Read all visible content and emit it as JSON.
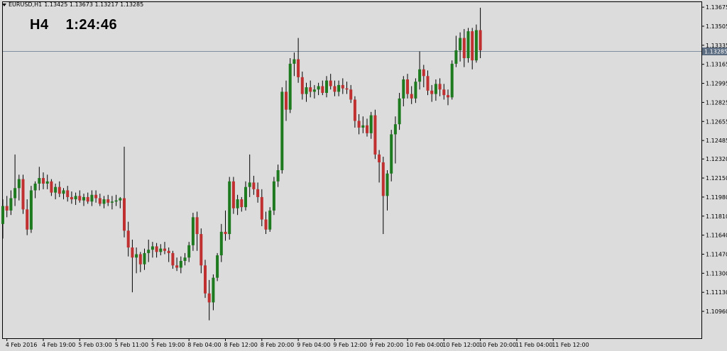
{
  "header": {
    "symbol": "EURUSD,H1",
    "ohlc": "1.13425 1.13673 1.13217 1.13285"
  },
  "timer": {
    "timeframe": "H4",
    "countdown": "1:24:46"
  },
  "colors": {
    "background": "#dcdcdc",
    "bull": "#1e7a1e",
    "bear": "#c03030",
    "wick": "#000000",
    "price_line": "#7f8fa0",
    "price_tag_bg": "#5c6d82",
    "grid_border": "#000000"
  },
  "chart_data": {
    "type": "candlestick",
    "symbol": "EURUSD",
    "period": "H1",
    "ylim": [
      1.1072,
      1.1372
    ],
    "current_price": 1.13285,
    "current_price_label": "1.13285",
    "y_ticks": [
      1.13675,
      1.13505,
      1.13335,
      1.13165,
      1.12995,
      1.12825,
      1.12655,
      1.12485,
      1.1232,
      1.1215,
      1.1198,
      1.1181,
      1.1164,
      1.1147,
      1.113,
      1.1113,
      1.1096
    ],
    "y_tick_labels": [
      "1.13675",
      "1.13505",
      "1.13335",
      "1.13165",
      "1.12995",
      "1.12825",
      "1.12655",
      "1.12485",
      "1.12320",
      "1.12150",
      "1.11980",
      "1.11810",
      "1.11640",
      "1.11470",
      "1.11300",
      "1.11130",
      "1.10960"
    ],
    "x_labels": [
      "4 Feb 2016",
      "4 Feb 19:00",
      "5 Feb 03:00",
      "5 Feb 11:00",
      "5 Feb 19:00",
      "8 Feb 04:00",
      "8 Feb 12:00",
      "8 Feb 20:00",
      "9 Feb 04:00",
      "9 Feb 12:00",
      "9 Feb 20:00",
      "10 Feb 04:00",
      "10 Feb 12:00",
      "10 Feb 20:00",
      "11 Feb 04:00",
      "11 Feb 12:00"
    ],
    "x_label_bars": [
      1,
      10,
      19,
      28,
      37,
      46,
      55,
      64,
      73,
      82,
      91,
      100,
      109,
      118,
      127,
      136
    ],
    "candles": [
      [
        1.1174,
        1.1196,
        1.1161,
        1.119
      ],
      [
        1.119,
        1.1199,
        1.118,
        1.1186
      ],
      [
        1.1186,
        1.1204,
        1.1182,
        1.1197
      ],
      [
        1.1197,
        1.1236,
        1.119,
        1.1206
      ],
      [
        1.1206,
        1.1218,
        1.1195,
        1.1214
      ],
      [
        1.1214,
        1.1218,
        1.1183,
        1.1187
      ],
      [
        1.1187,
        1.1196,
        1.1164,
        1.1169
      ],
      [
        1.1169,
        1.1208,
        1.1166,
        1.1204
      ],
      [
        1.1204,
        1.1212,
        1.1197,
        1.121
      ],
      [
        1.121,
        1.1225,
        1.1204,
        1.1215
      ],
      [
        1.1215,
        1.122,
        1.1205,
        1.121
      ],
      [
        1.121,
        1.1218,
        1.1205,
        1.1212
      ],
      [
        1.1212,
        1.1214,
        1.1199,
        1.1202
      ],
      [
        1.1202,
        1.121,
        1.1196,
        1.1207
      ],
      [
        1.1207,
        1.1212,
        1.1198,
        1.1201
      ],
      [
        1.1201,
        1.1206,
        1.1196,
        1.1204
      ],
      [
        1.1204,
        1.1208,
        1.1194,
        1.1198
      ],
      [
        1.1198,
        1.1203,
        1.1192,
        1.1196
      ],
      [
        1.1196,
        1.1202,
        1.1191,
        1.1199
      ],
      [
        1.1199,
        1.1204,
        1.1193,
        1.1195
      ],
      [
        1.1195,
        1.1201,
        1.119,
        1.1198
      ],
      [
        1.1198,
        1.1202,
        1.1192,
        1.1194
      ],
      [
        1.1194,
        1.1204,
        1.119,
        1.12
      ],
      [
        1.12,
        1.1204,
        1.1193,
        1.1197
      ],
      [
        1.1197,
        1.1201,
        1.119,
        1.1192
      ],
      [
        1.1192,
        1.1199,
        1.1188,
        1.1196
      ],
      [
        1.1196,
        1.12,
        1.119,
        1.1193
      ],
      [
        1.1193,
        1.1199,
        1.1187,
        1.1194
      ],
      [
        1.1194,
        1.12,
        1.119,
        1.1195
      ],
      [
        1.1195,
        1.1198,
        1.1188,
        1.1197
      ],
      [
        1.1197,
        1.1243,
        1.1162,
        1.1168
      ],
      [
        1.1168,
        1.1176,
        1.1145,
        1.1153
      ],
      [
        1.1153,
        1.116,
        1.1113,
        1.1144
      ],
      [
        1.1144,
        1.1153,
        1.113,
        1.1147
      ],
      [
        1.1147,
        1.1149,
        1.1131,
        1.1138
      ],
      [
        1.1138,
        1.1152,
        1.1133,
        1.1148
      ],
      [
        1.1148,
        1.116,
        1.114,
        1.1151
      ],
      [
        1.1151,
        1.1158,
        1.1144,
        1.1154
      ],
      [
        1.1154,
        1.1157,
        1.1144,
        1.1149
      ],
      [
        1.1149,
        1.1156,
        1.1146,
        1.1152
      ],
      [
        1.1152,
        1.1158,
        1.1147,
        1.115
      ],
      [
        1.115,
        1.1153,
        1.114,
        1.1148
      ],
      [
        1.1148,
        1.115,
        1.1134,
        1.1137
      ],
      [
        1.1137,
        1.1144,
        1.1132,
        1.1135
      ],
      [
        1.1135,
        1.1145,
        1.113,
        1.1141
      ],
      [
        1.1141,
        1.1148,
        1.1137,
        1.1144
      ],
      [
        1.1144,
        1.1158,
        1.114,
        1.1155
      ],
      [
        1.1155,
        1.1184,
        1.115,
        1.118
      ],
      [
        1.118,
        1.1185,
        1.115,
        1.1165
      ],
      [
        1.1165,
        1.117,
        1.113,
        1.1137
      ],
      [
        1.1137,
        1.1142,
        1.1108,
        1.1112
      ],
      [
        1.1112,
        1.1124,
        1.1088,
        1.1104
      ],
      [
        1.1104,
        1.1129,
        1.1097,
        1.1126
      ],
      [
        1.1126,
        1.1148,
        1.1123,
        1.1146
      ],
      [
        1.1146,
        1.1174,
        1.114,
        1.1167
      ],
      [
        1.1167,
        1.1186,
        1.1159,
        1.1165
      ],
      [
        1.1165,
        1.1216,
        1.116,
        1.1212
      ],
      [
        1.1212,
        1.1216,
        1.1183,
        1.1188
      ],
      [
        1.1188,
        1.12,
        1.1182,
        1.1196
      ],
      [
        1.1196,
        1.1198,
        1.1185,
        1.1189
      ],
      [
        1.1189,
        1.1212,
        1.1186,
        1.1207
      ],
      [
        1.1207,
        1.1236,
        1.1198,
        1.1211
      ],
      [
        1.1211,
        1.1217,
        1.12,
        1.1205
      ],
      [
        1.1205,
        1.1211,
        1.1193,
        1.1198
      ],
      [
        1.1198,
        1.1205,
        1.1172,
        1.1178
      ],
      [
        1.1178,
        1.1185,
        1.1165,
        1.1169
      ],
      [
        1.1169,
        1.1189,
        1.1167,
        1.1186
      ],
      [
        1.1186,
        1.1216,
        1.1182,
        1.1212
      ],
      [
        1.1212,
        1.1227,
        1.1207,
        1.1222
      ],
      [
        1.1222,
        1.1296,
        1.1219,
        1.1292
      ],
      [
        1.1292,
        1.1302,
        1.1266,
        1.1276
      ],
      [
        1.1276,
        1.1322,
        1.1273,
        1.1317
      ],
      [
        1.1317,
        1.1327,
        1.1306,
        1.1321
      ],
      [
        1.1321,
        1.134,
        1.13,
        1.1305
      ],
      [
        1.1305,
        1.131,
        1.1285,
        1.129
      ],
      [
        1.129,
        1.13,
        1.1283,
        1.1296
      ],
      [
        1.1296,
        1.1302,
        1.1287,
        1.1292
      ],
      [
        1.1292,
        1.1298,
        1.1286,
        1.1294
      ],
      [
        1.1294,
        1.13,
        1.1289,
        1.1297
      ],
      [
        1.1297,
        1.1302,
        1.1289,
        1.1291
      ],
      [
        1.1291,
        1.1306,
        1.1287,
        1.1302
      ],
      [
        1.1302,
        1.1308,
        1.1294,
        1.1297
      ],
      [
        1.1297,
        1.1302,
        1.1288,
        1.1292
      ],
      [
        1.1292,
        1.1302,
        1.1288,
        1.1298
      ],
      [
        1.1298,
        1.1304,
        1.129,
        1.1295
      ],
      [
        1.1295,
        1.1301,
        1.129,
        1.1294
      ],
      [
        1.1294,
        1.1298,
        1.1282,
        1.1285
      ],
      [
        1.1285,
        1.1288,
        1.126,
        1.1266
      ],
      [
        1.1266,
        1.1272,
        1.1254,
        1.126
      ],
      [
        1.126,
        1.127,
        1.1255,
        1.1262
      ],
      [
        1.1262,
        1.1268,
        1.1252,
        1.1255
      ],
      [
        1.1255,
        1.1274,
        1.125,
        1.1271
      ],
      [
        1.1271,
        1.1276,
        1.1232,
        1.1236
      ],
      [
        1.1236,
        1.124,
        1.1211,
        1.1229
      ],
      [
        1.1229,
        1.1234,
        1.1165,
        1.1199
      ],
      [
        1.1199,
        1.1222,
        1.1186,
        1.1219
      ],
      [
        1.1219,
        1.1258,
        1.1212,
        1.1254
      ],
      [
        1.1254,
        1.127,
        1.1228,
        1.1263
      ],
      [
        1.1263,
        1.1291,
        1.1258,
        1.1286
      ],
      [
        1.1286,
        1.1306,
        1.1279,
        1.1303
      ],
      [
        1.1303,
        1.1308,
        1.1286,
        1.129
      ],
      [
        1.129,
        1.1297,
        1.1281,
        1.1286
      ],
      [
        1.1286,
        1.1304,
        1.1282,
        1.1301
      ],
      [
        1.1301,
        1.1328,
        1.1294,
        1.1312
      ],
      [
        1.1312,
        1.1316,
        1.1296,
        1.1306
      ],
      [
        1.1306,
        1.1311,
        1.1289,
        1.1293
      ],
      [
        1.1293,
        1.1298,
        1.1283,
        1.129
      ],
      [
        1.129,
        1.1303,
        1.1284,
        1.1299
      ],
      [
        1.1299,
        1.1304,
        1.1288,
        1.1294
      ],
      [
        1.1294,
        1.1299,
        1.1285,
        1.1289
      ],
      [
        1.1289,
        1.1294,
        1.128,
        1.1287
      ],
      [
        1.1287,
        1.132,
        1.1285,
        1.1317
      ],
      [
        1.1317,
        1.1342,
        1.1314,
        1.1329
      ],
      [
        1.1329,
        1.1345,
        1.1319,
        1.134
      ],
      [
        1.134,
        1.1348,
        1.1314,
        1.1322
      ],
      [
        1.1322,
        1.1349,
        1.1318,
        1.1346
      ],
      [
        1.1346,
        1.1349,
        1.1312,
        1.132
      ],
      [
        1.132,
        1.1352,
        1.1318,
        1.1347
      ],
      [
        1.1347,
        1.1367,
        1.1322,
        1.1329
      ]
    ]
  }
}
